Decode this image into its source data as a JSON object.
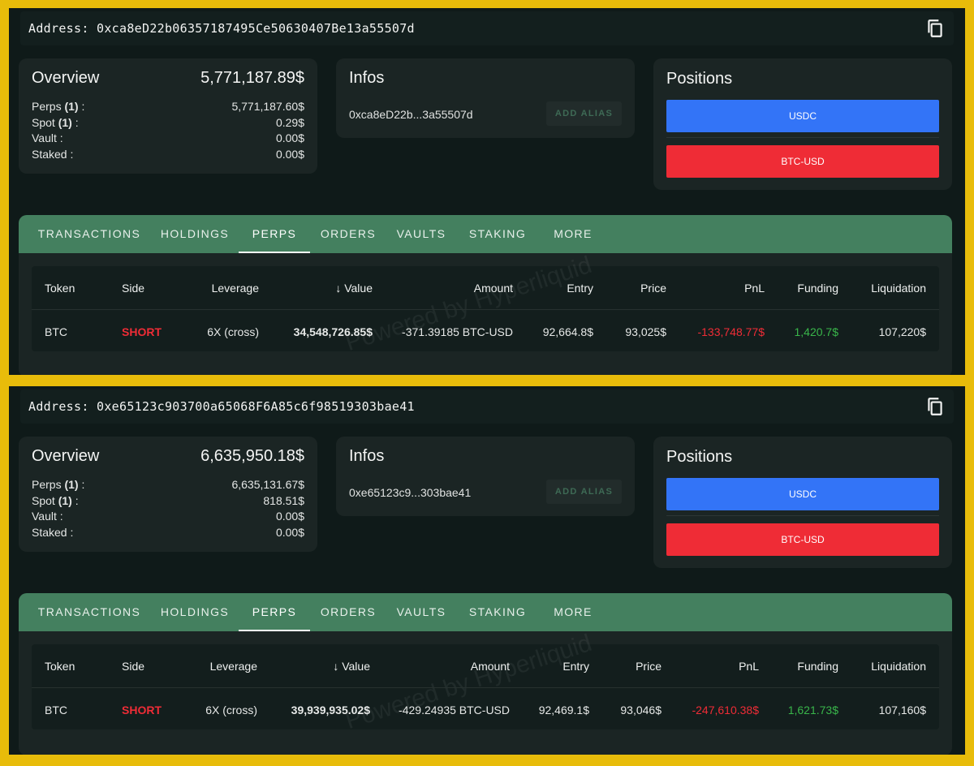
{
  "icons": {
    "copy": "copy-icon",
    "sort": "arrow-down-icon"
  },
  "colors": {
    "usdc": "#3374f7",
    "btc": "#ef2c36",
    "tab_bar": "#44805f",
    "negative": "#ef2c36",
    "positive": "#39b54a",
    "frame": "#e8bc0a"
  },
  "accounts": [
    {
      "address_label": "Address:",
      "address": "0xca8eD22b06357187495Ce50630407Be13a55507d",
      "overview": {
        "title": "Overview",
        "total": "5,771,187.89$",
        "rows": [
          {
            "label": "Perps",
            "count": "(1)",
            "suffix": " :",
            "value": "5,771,187.60$"
          },
          {
            "label": "Spot",
            "count": "(1)",
            "suffix": " :",
            "value": "0.29$"
          },
          {
            "label": "Vault :",
            "count": "",
            "suffix": "",
            "value": "0.00$"
          },
          {
            "label": "Staked :",
            "count": "",
            "suffix": "",
            "value": "0.00$"
          }
        ]
      },
      "infos": {
        "title": "Infos",
        "short_address": "0xca8eD22b...3a55507d",
        "alias_button": "ADD ALIAS"
      },
      "positions": {
        "title": "Positions",
        "items": [
          "USDC",
          "BTC-USD"
        ]
      },
      "tabs": [
        "TRANSACTIONS",
        "HOLDINGS",
        "PERPS",
        "ORDERS",
        "VAULTS",
        "STAKING",
        "MORE"
      ],
      "active_tab": "PERPS",
      "table": {
        "headers": [
          "Token",
          "Side",
          "Leverage",
          "Value",
          "Amount",
          "Entry",
          "Price",
          "PnL",
          "Funding",
          "Liquidation"
        ],
        "rows": [
          [
            "BTC",
            "SHORT",
            "6X (cross)",
            "34,548,726.85$",
            "-371.39185 BTC-USD",
            "92,664.8$",
            "93,025$",
            "-133,748.77$",
            "1,420.7$",
            "107,220$"
          ]
        ]
      },
      "watermark": "Powered by Hyperliquid"
    },
    {
      "address_label": "Address:",
      "address": "0xe65123c903700a65068F6A85c6f98519303bae41",
      "overview": {
        "title": "Overview",
        "total": "6,635,950.18$",
        "rows": [
          {
            "label": "Perps",
            "count": "(1)",
            "suffix": " :",
            "value": "6,635,131.67$"
          },
          {
            "label": "Spot",
            "count": "(1)",
            "suffix": " :",
            "value": "818.51$"
          },
          {
            "label": "Vault :",
            "count": "",
            "suffix": "",
            "value": "0.00$"
          },
          {
            "label": "Staked :",
            "count": "",
            "suffix": "",
            "value": "0.00$"
          }
        ]
      },
      "infos": {
        "title": "Infos",
        "short_address": "0xe65123c9...303bae41",
        "alias_button": "ADD ALIAS"
      },
      "positions": {
        "title": "Positions",
        "items": [
          "USDC",
          "BTC-USD"
        ]
      },
      "tabs": [
        "TRANSACTIONS",
        "HOLDINGS",
        "PERPS",
        "ORDERS",
        "VAULTS",
        "STAKING",
        "MORE"
      ],
      "active_tab": "PERPS",
      "table": {
        "headers": [
          "Token",
          "Side",
          "Leverage",
          "Value",
          "Amount",
          "Entry",
          "Price",
          "PnL",
          "Funding",
          "Liquidation"
        ],
        "rows": [
          [
            "BTC",
            "SHORT",
            "6X (cross)",
            "39,939,935.02$",
            "-429.24935 BTC-USD",
            "92,469.1$",
            "93,046$",
            "-247,610.38$",
            "1,621.73$",
            "107,160$"
          ]
        ]
      },
      "watermark": "Powered by Hyperliquid"
    }
  ]
}
